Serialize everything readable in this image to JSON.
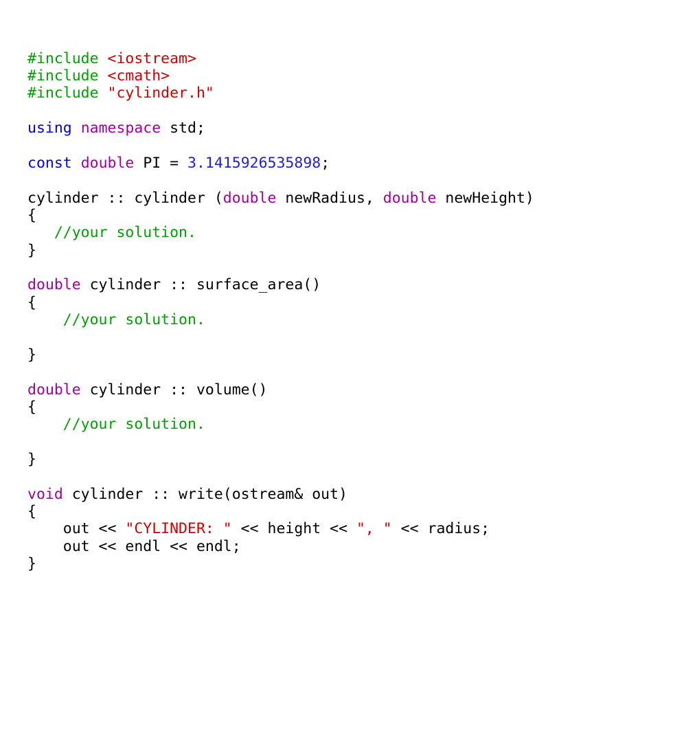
{
  "code": {
    "l1": {
      "a": "#include ",
      "b": "<iostream>"
    },
    "l2": {
      "a": "#include ",
      "b": "<cmath>"
    },
    "l3": {
      "a": "#include ",
      "b": "\"cylinder.h\""
    },
    "blank1": "",
    "l5": {
      "a": "using",
      "sp1": " ",
      "b": "namespace",
      "sp2": " ",
      "c": "std;"
    },
    "blank2": "",
    "l7": {
      "a": "const",
      "sp1": " ",
      "b": "double",
      "sp2": " ",
      "c": "PI = ",
      "d": "3.1415926535898",
      "e": ";"
    },
    "blank3": "",
    "l9": {
      "a": "cylinder :: cylinder (",
      "b": "double",
      "c": " newRadius, ",
      "d": "double",
      "e": " newHeight)"
    },
    "l10": "{",
    "l11": {
      "indent": "   ",
      "a": "//your solution."
    },
    "l12": "}",
    "blank4": "",
    "l14": {
      "a": "double",
      "b": " cylinder :: surface_area()"
    },
    "l15": "{",
    "l16": {
      "indent": "    ",
      "a": "//your solution."
    },
    "blank5": "",
    "l18": "}",
    "blank6": "",
    "l20": {
      "a": "double",
      "b": " cylinder :: volume()"
    },
    "l21": "{",
    "l22": {
      "indent": "    ",
      "a": "//your solution."
    },
    "blank7": "",
    "l24": "}",
    "blank8": "",
    "l26": {
      "a": "void",
      "b": " cylinder :: write(ostream& out)"
    },
    "l27": "{",
    "l28": {
      "indent": "    ",
      "a": "out << ",
      "b": "\"CYLINDER: \"",
      "c": " << height << ",
      "d": "\", \"",
      "e": " << radius;"
    },
    "l29": {
      "indent": "    ",
      "a": "out << endl << endl;"
    },
    "l30": "}"
  }
}
